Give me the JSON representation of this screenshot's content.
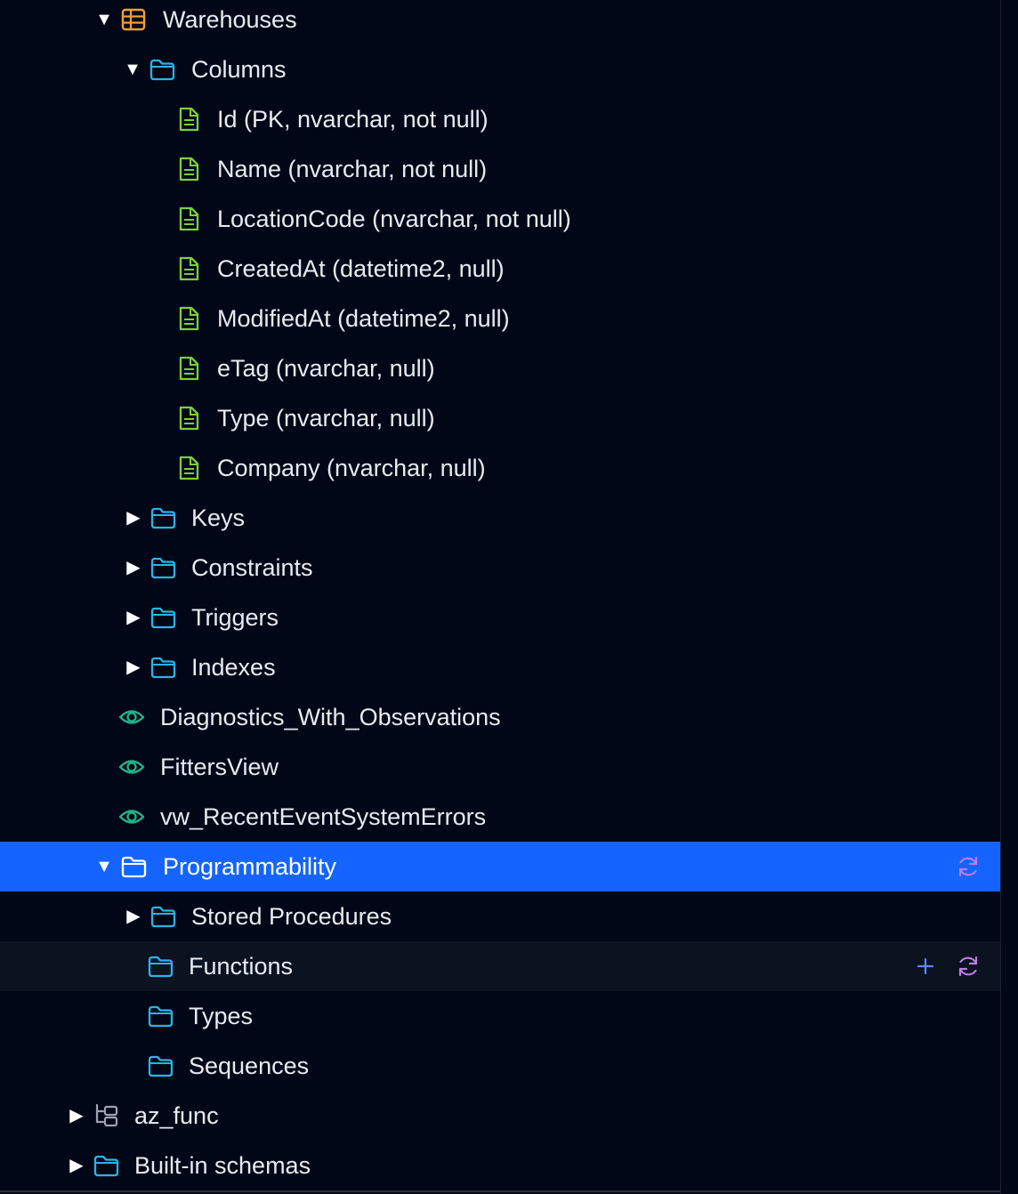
{
  "tree": {
    "warehouses": "Warehouses",
    "columns": "Columns",
    "column_items": [
      "Id (PK, nvarchar, not null)",
      "Name (nvarchar, not null)",
      "LocationCode (nvarchar, not null)",
      "CreatedAt (datetime2, null)",
      "ModifiedAt (datetime2, null)",
      "eTag (nvarchar, null)",
      "Type (nvarchar, null)",
      "Company (nvarchar, null)"
    ],
    "table_folders": [
      "Keys",
      "Constraints",
      "Triggers",
      "Indexes"
    ],
    "views": [
      "Diagnostics_With_Observations",
      "FittersView",
      "vw_RecentEventSystemErrors"
    ],
    "programmability": "Programmability",
    "stored_procedures": "Stored Procedures",
    "functions": "Functions",
    "types": "Types",
    "sequences": "Sequences",
    "az_func": "az_func",
    "builtin_schemas": "Built-in schemas"
  },
  "glyphs": {
    "expanded": "▼",
    "collapsed": "▶"
  },
  "icons": {
    "table": "table-icon",
    "folder": "folder-icon",
    "column": "document-icon",
    "view": "eye-icon",
    "schema": "schema-icon",
    "refresh": "refresh-icon",
    "add": "plus-icon"
  },
  "colors": {
    "background": "#010717",
    "selected_row": "#1664ff",
    "hover_row": "#0b1220",
    "folder": "#2bb3e6",
    "table": "#f0a030",
    "column": "#7ccf3a",
    "view": "#1fb38a",
    "refresh": "#c07ae8",
    "plus": "#5f86ff",
    "text": "#e8ebf2"
  }
}
